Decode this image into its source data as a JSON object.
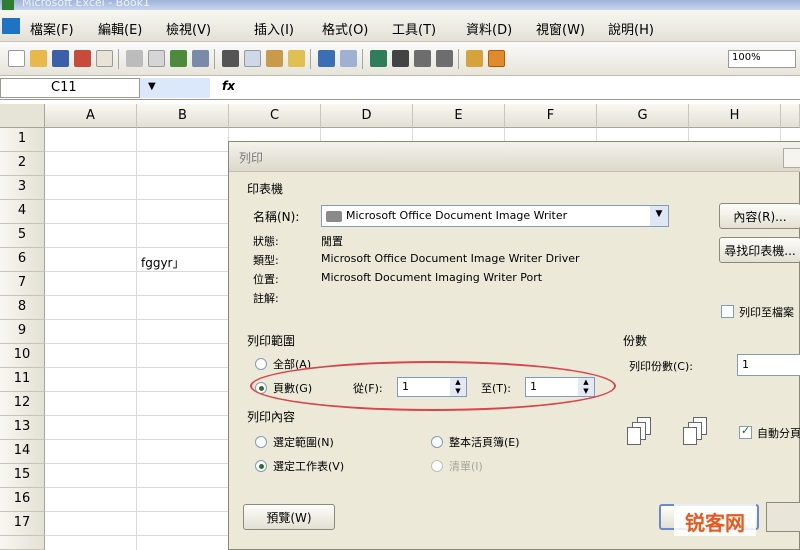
{
  "window": {
    "title": "Microsoft Excel - Book1"
  },
  "menu": [
    "檔案(F)",
    "編輯(E)",
    "檢視(V)",
    "插入(I)",
    "格式(O)",
    "工具(T)",
    "資料(D)",
    "視窗(W)",
    "說明(H)"
  ],
  "toolbar": {
    "zoom": "100%"
  },
  "formula_bar": {
    "name_box": "C11",
    "fx": "fx"
  },
  "sheet": {
    "columns": [
      "A",
      "B",
      "C",
      "D",
      "E",
      "F",
      "G",
      "H"
    ],
    "rows": [
      "1",
      "2",
      "3",
      "4",
      "5",
      "6",
      "7",
      "8",
      "9",
      "10",
      "11",
      "12",
      "13",
      "14",
      "15",
      "16",
      "17"
    ],
    "cell_b6": "fggyr」"
  },
  "dialog": {
    "title": "列印",
    "printer_group": "印表機",
    "name_label": "名稱(N):",
    "printer_name": "Microsoft Office Document Image Writer",
    "status_label": "狀態:",
    "status_value": "閒置",
    "type_label": "類型:",
    "type_value": "Microsoft Office Document Image Writer Driver",
    "where_label": "位置:",
    "where_value": "Microsoft Document Imaging Writer Port",
    "comment_label": "註解:",
    "properties_button": "內容(R)...",
    "find_printer_button": "尋找印表機...",
    "print_to_file": "列印至檔案",
    "range_group": "列印範圍",
    "range_all": "全部(A)",
    "range_pages": "頁數(G)",
    "from_label": "從(F):",
    "from_value": "1",
    "to_label": "至(T):",
    "to_value": "1",
    "what_group": "列印內容",
    "what_selection": "選定範圍(N)",
    "what_whole_workbook": "整本活頁簿(E)",
    "what_active_sheets": "選定工作表(V)",
    "what_list": "清單(I)",
    "copies_group": "份數",
    "copies_label": "列印份數(C):",
    "copies_value": "1",
    "collate": "自動分頁",
    "preview_button": "預覽(W)"
  },
  "watermark": "锐客网"
}
